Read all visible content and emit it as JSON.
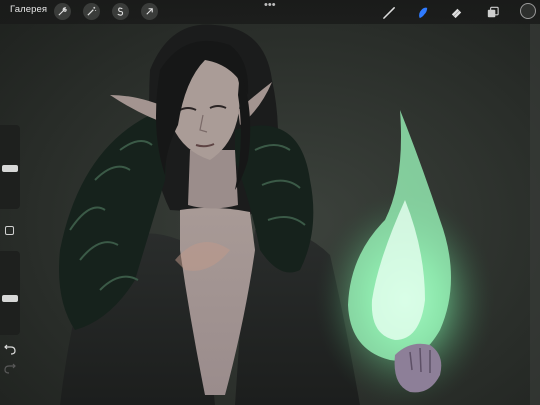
{
  "topbar": {
    "gallery_label": "Галерея",
    "actions": [
      {
        "name": "wrench-icon"
      },
      {
        "name": "magic-wand-icon"
      },
      {
        "name": "selection-icon"
      },
      {
        "name": "transform-arrow-icon"
      }
    ],
    "more_handle": "•••",
    "tools": [
      {
        "name": "brush-icon",
        "active": false
      },
      {
        "name": "smudge-icon",
        "active": true
      },
      {
        "name": "eraser-icon",
        "active": false
      },
      {
        "name": "layers-icon",
        "active": false
      }
    ]
  },
  "sidebar": {
    "size_slider_value": 0.9,
    "opacity_slider_value": 0.5
  },
  "colors": {
    "active_tool": "#2f7bff",
    "toolbar_bg": "#1a1b1a",
    "flame": "#9fffc0",
    "current_color": "#2e302e"
  }
}
